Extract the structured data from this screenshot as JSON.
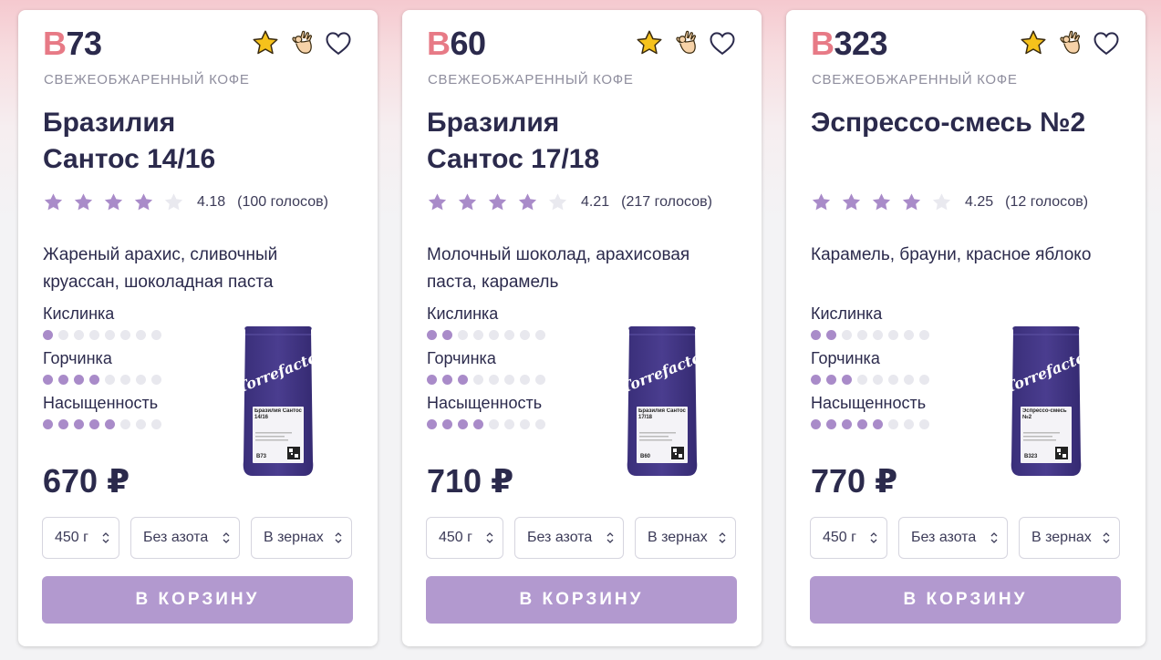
{
  "products": [
    {
      "code_letter": "B",
      "code_number": "73",
      "subtitle": "СВЕЖЕОБЖАРЕННЫЙ КОФЕ",
      "title_line1": "Бразилия",
      "title_line2": "Сантос 14/16",
      "rating_stars": 4,
      "rating_score": "4.18",
      "votes": "(100 голосов)",
      "notes": "Жареный арахис, сливочный круассан, шоколадная паста",
      "attributes": [
        {
          "label": "Кислинка",
          "level": 1,
          "max": 8
        },
        {
          "label": "Горчинка",
          "level": 4,
          "max": 8
        },
        {
          "label": "Насыщенность",
          "level": 5,
          "max": 8
        }
      ],
      "bag_label": "Бразилия Сантос 14/16",
      "price": "670 ₽",
      "weight": "450 г",
      "nitrogen": "Без азота",
      "grind": "В зернах",
      "cta": "В КОРЗИНУ"
    },
    {
      "code_letter": "B",
      "code_number": "60",
      "subtitle": "СВЕЖЕОБЖАРЕННЫЙ КОФЕ",
      "title_line1": "Бразилия",
      "title_line2": "Сантос 17/18",
      "rating_stars": 4,
      "rating_score": "4.21",
      "votes": "(217 голосов)",
      "notes": "Молочный шоколад, арахисовая паста, карамель",
      "attributes": [
        {
          "label": "Кислинка",
          "level": 2,
          "max": 8
        },
        {
          "label": "Горчинка",
          "level": 3,
          "max": 8
        },
        {
          "label": "Насыщенность",
          "level": 4,
          "max": 8
        }
      ],
      "bag_label": "Бразилия Сантос 17/18",
      "price": "710 ₽",
      "weight": "450 г",
      "nitrogen": "Без азота",
      "grind": "В зернах",
      "cta": "В КОРЗИНУ"
    },
    {
      "code_letter": "B",
      "code_number": "323",
      "subtitle": "СВЕЖЕОБЖАРЕННЫЙ КОФЕ",
      "title_line1": "Эспрессо-смесь №2",
      "title_line2": "",
      "rating_stars": 4,
      "rating_score": "4.25",
      "votes": "(12 голосов)",
      "notes": "Карамель, брауни, красное яблоко",
      "attributes": [
        {
          "label": "Кислинка",
          "level": 2,
          "max": 8
        },
        {
          "label": "Горчинка",
          "level": 3,
          "max": 8
        },
        {
          "label": "Насыщенность",
          "level": 5,
          "max": 8
        }
      ],
      "bag_label": "Эспрессо-смесь №2",
      "price": "770 ₽",
      "weight": "450 г",
      "nitrogen": "Без азота",
      "grind": "В зернах",
      "cta": "В КОРЗИНУ"
    }
  ],
  "brand": "Torrefacto",
  "icons": [
    "star-icon",
    "ok-hand-icon",
    "heart-icon",
    "chevron-updown-icon"
  ],
  "colors": {
    "accent_code": "#e77a86",
    "dark_text": "#2b2a4c",
    "rating_star": "#a98bc9",
    "button": "#b299cf",
    "bag": "#4a3d8f"
  }
}
